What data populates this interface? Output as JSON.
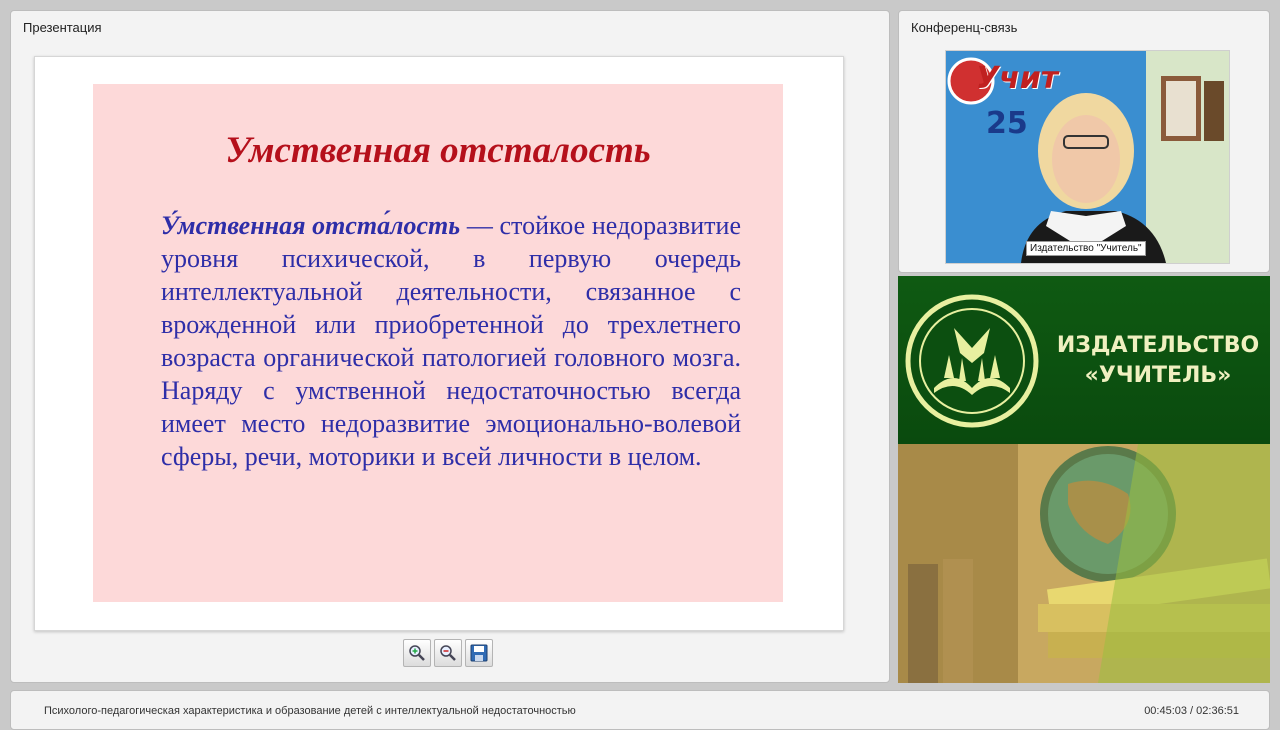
{
  "presentation": {
    "panel_title": "Презентация",
    "slide": {
      "heading": "Умственная отсталость",
      "term": "У́мственная отста́лость",
      "body": " — стойкое недоразвитие уровня психической, в первую очередь интеллектуальной деятельности, связанное с врожденной или приобретенной до трехлетнего возраста органической патологией головного мозга. Наряду с умственной недостаточностью всегда имеет место недоразвитие эмоционально-волевой сферы, речи, моторики и всей личности в целом."
    },
    "toolbar": {
      "zoom_in_icon": "zoom-in-icon",
      "zoom_out_icon": "zoom-out-icon",
      "save_icon": "floppy-disk-icon"
    }
  },
  "conference": {
    "panel_title": "Конференц-связь",
    "video_label": "Издательство \"Учитель\""
  },
  "banner": {
    "line1": "ИЗДАТЕЛЬСТВО",
    "line2": "«УЧИТЕЛЬ»"
  },
  "bottom": {
    "title": "Психолого-педагогическая характеристика и образование детей с интеллектуальной недостаточностью",
    "time": "00:45:03 / 02:36:51"
  }
}
